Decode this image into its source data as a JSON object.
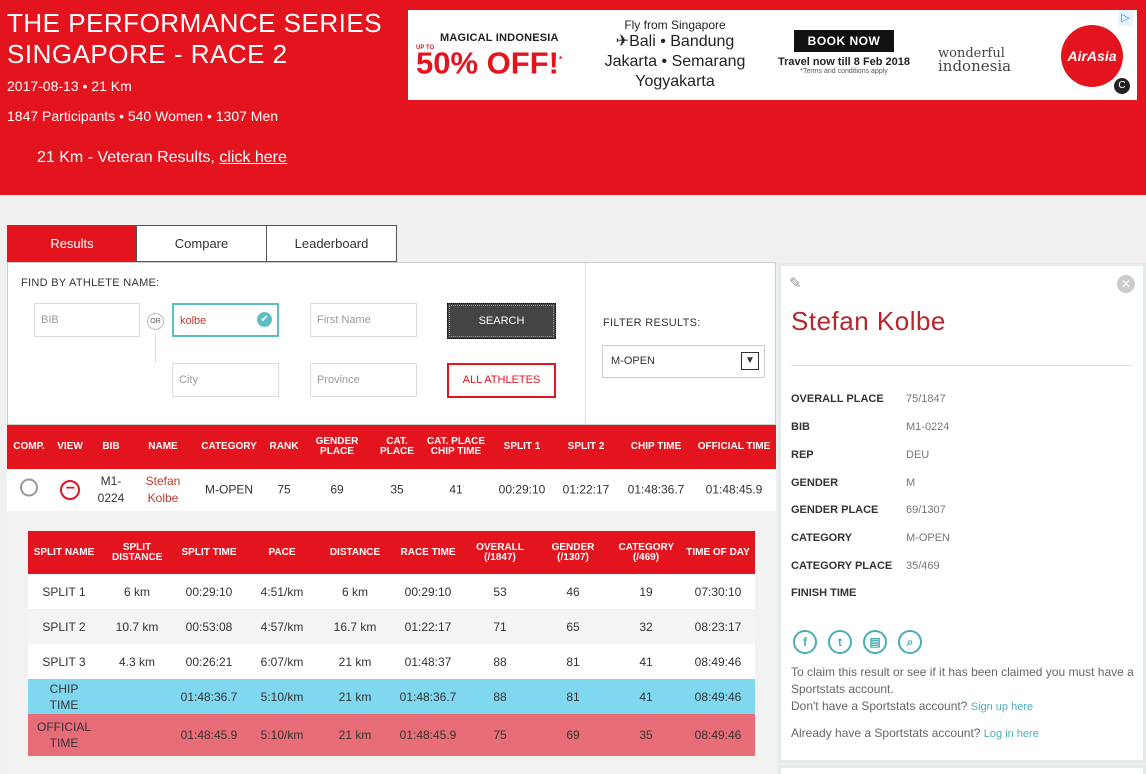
{
  "event": {
    "title_line1": "THE PERFORMANCE SERIES",
    "title_line2": "SINGAPORE - RACE 2",
    "meta": "2017-08-13 • 21 Km",
    "counts": "1847 Participants • 540 Women • 1307 Men",
    "veteran_text": "21 Km - Veteran Results, ",
    "veteran_link": "click here"
  },
  "ad": {
    "magic": "MAGICAL INDONESIA",
    "upto": "UP TO",
    "sale": "50% OFF!",
    "sale_mark": "*",
    "fly": "Fly from Singapore",
    "dest_line1": "✈Bali • Bandung",
    "dest_line2": "Jakarta • Semarang",
    "dest_line3": "Yogyakarta",
    "book": "BOOK NOW",
    "travel": "Travel now till 8 Feb 2018",
    "terms": "*Terms and conditions apply",
    "wonderful": "wonderful",
    "indonesia": "indonesia",
    "airline": "AirAsia"
  },
  "tabs": [
    "Results",
    "Compare",
    "Leaderboard"
  ],
  "search": {
    "find_label": "FIND BY ATHLETE NAME:",
    "bib_placeholder": "BIB",
    "or": "OR",
    "last_name_value": "kolbe",
    "first_name_placeholder": "First Name",
    "city_placeholder": "City",
    "province_placeholder": "Province",
    "search_label": "SEARCH",
    "all_athletes_label": "ALL ATHLETES",
    "filter_label": "FILTER RESULTS:",
    "filter_value": "M-OPEN"
  },
  "results": {
    "headers": [
      "COMP.",
      "VIEW",
      "BIB",
      "NAME",
      "CATEGORY",
      "RANK",
      "GENDER PLACE",
      "CAT. PLACE",
      "CAT. PLACE CHIP TIME",
      "SPLIT 1",
      "SPLIT 2",
      "CHIP TIME",
      "OFFICIAL TIME"
    ],
    "row": {
      "bib": "M1-0224",
      "name": "Stefan Kolbe",
      "category": "M-OPEN",
      "rank": "75",
      "gender_place": "69",
      "cat_place": "35",
      "cat_place_chip": "41",
      "split1": "00:29:10",
      "split2": "01:22:17",
      "chip_time": "01:48:36.7",
      "official_time": "01:48:45.9"
    }
  },
  "splits": {
    "headers": [
      "SPLIT NAME",
      "SPLIT DISTANCE",
      "SPLIT TIME",
      "PACE",
      "DISTANCE",
      "RACE TIME",
      "OVERALL (/1847)",
      "GENDER (/1307)",
      "CATEGORY (/469)",
      "TIME OF DAY"
    ],
    "rows": [
      [
        "SPLIT 1",
        "6 km",
        "00:29:10",
        "4:51/km",
        "6 km",
        "00:29:10",
        "53",
        "46",
        "19",
        "07:30:10"
      ],
      [
        "SPLIT 2",
        "10.7 km",
        "00:53:08",
        "4:57/km",
        "16.7 km",
        "01:22:17",
        "71",
        "65",
        "32",
        "08:23:17"
      ],
      [
        "SPLIT 3",
        "4.3 km",
        "00:26:21",
        "6:07/km",
        "21 km",
        "01:48:37",
        "88",
        "81",
        "41",
        "08:49:46"
      ],
      [
        "CHIP TIME",
        "",
        "01:48:36.7",
        "5:10/km",
        "21 km",
        "01:48:36.7",
        "88",
        "81",
        "41",
        "08:49:46"
      ],
      [
        "OFFICIAL TIME",
        "",
        "01:48:45.9",
        "5:10/km",
        "21 km",
        "01:48:45.9",
        "75",
        "69",
        "35",
        "08:49:46"
      ]
    ]
  },
  "athlete": {
    "name": "Stefan Kolbe",
    "details": [
      {
        "k": "OVERALL PLACE",
        "v": "75/1847"
      },
      {
        "k": "BIB",
        "v": "M1-0224"
      },
      {
        "k": "REP",
        "v": "DEU"
      },
      {
        "k": "GENDER",
        "v": "M"
      },
      {
        "k": "GENDER PLACE",
        "v": "69/1307"
      },
      {
        "k": "CATEGORY",
        "v": "M-OPEN"
      },
      {
        "k": "CATEGORY PLACE",
        "v": "35/469"
      },
      {
        "k": "FINISH TIME",
        "v": ""
      }
    ],
    "claim_text": "To claim this result or see if it has been claimed you must have a Sportstats account.",
    "no_account_text": "Don't have a Sportstats account? ",
    "sign_up": "Sign up here",
    "already_text": "Already have a Sportstats account? ",
    "log_in": "Log in here"
  },
  "colors": {
    "brand_red": "#e3141e",
    "teal": "#4aaeb8",
    "chip_row": "#7fd8f0",
    "official_row": "#e96d78"
  }
}
